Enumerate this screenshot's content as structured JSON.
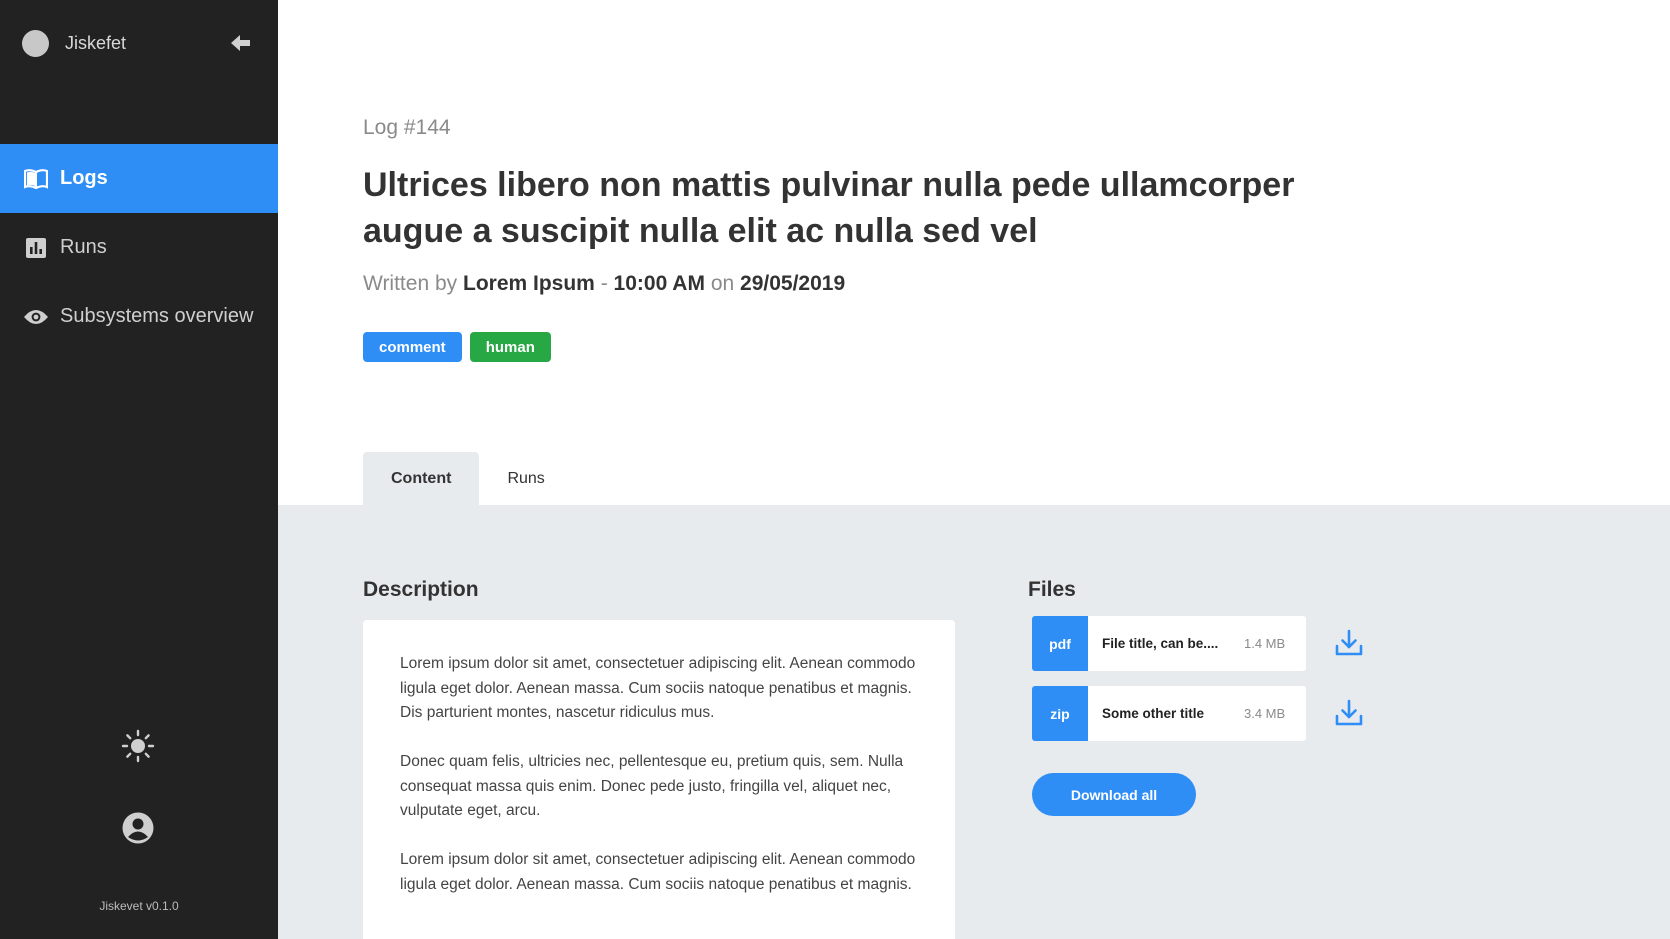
{
  "app": {
    "name": "Jiskefet",
    "version": "Jiskevet v0.1.0"
  },
  "sidebar": {
    "items": [
      {
        "label": "Logs",
        "icon": "book-icon",
        "active": true
      },
      {
        "label": "Runs",
        "icon": "bar-chart-icon",
        "active": false
      },
      {
        "label": "Subsystems overview",
        "icon": "eye-icon",
        "active": false
      }
    ]
  },
  "log": {
    "id_label": "Log #144",
    "title": "Ultrices libero non mattis pulvinar nulla pede ullamcorper augue a suscipit nulla elit ac nulla sed vel",
    "written_by_prefix": "Written by",
    "author": "Lorem Ipsum",
    "separator": "-",
    "time": "10:00 AM",
    "on_word": "on",
    "date": "29/05/2019",
    "tags": [
      "comment",
      "human"
    ]
  },
  "tabs": [
    {
      "label": "Content",
      "active": true
    },
    {
      "label": "Runs",
      "active": false
    }
  ],
  "description": {
    "title": "Description",
    "paragraphs": [
      "Lorem ipsum dolor sit amet, consectetuer adipiscing elit. Aenean commodo ligula eget dolor. Aenean massa. Cum sociis natoque penatibus et magnis.",
      "Dis parturient montes, nascetur ridiculus mus.",
      "Donec quam felis, ultricies nec, pellentesque eu, pretium quis, sem. Nulla consequat massa quis enim. Donec pede justo, fringilla vel, aliquet nec, vulputate eget, arcu.",
      "Lorem ipsum dolor sit amet, consectetuer adipiscing elit. Aenean commodo ligula eget dolor. Aenean massa. Cum sociis natoque penatibus et magnis."
    ]
  },
  "files": {
    "title": "Files",
    "items": [
      {
        "type": "pdf",
        "name": "File title, can be....",
        "size": "1.4 MB"
      },
      {
        "type": "zip",
        "name": "Some other title",
        "size": "3.4 MB"
      }
    ],
    "download_all_label": "Download all"
  },
  "colors": {
    "accent": "#2e8ef5",
    "success": "#28a745",
    "sidebar_bg": "#222222",
    "content_bg": "#e8ebee"
  }
}
